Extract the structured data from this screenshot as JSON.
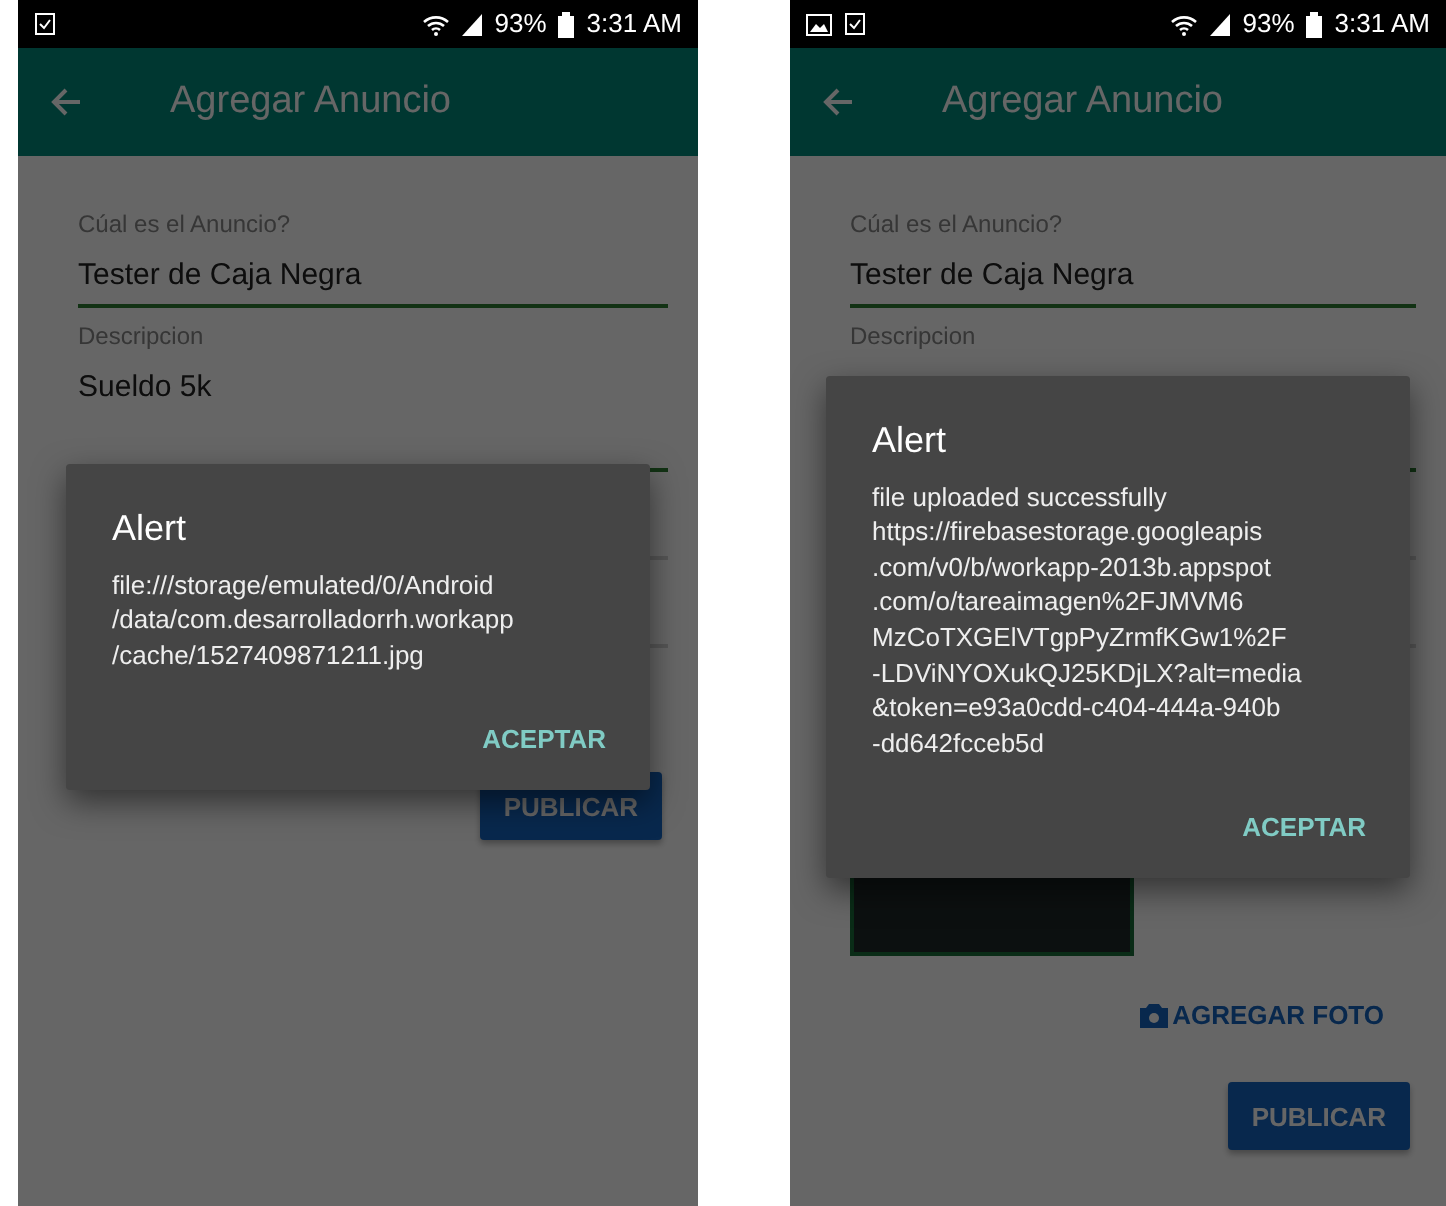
{
  "phones": [
    {
      "status_bar": {
        "notifications": [
          {
            "kind": "clipboard"
          }
        ],
        "battery": "93%",
        "time": "3:31 AM"
      },
      "app_bar": {
        "title": "Agregar Anuncio"
      },
      "form": {
        "fields": [
          {
            "kind": "text",
            "label": "Cúal es el Anuncio?",
            "value": "Tester de Caja Negra"
          },
          {
            "kind": "multiline",
            "label": "Descripcion",
            "value": "Sueldo 5k"
          },
          {
            "kind": "blank"
          },
          {
            "kind": "blank"
          }
        ],
        "publish_button": "PUBLICAR"
      },
      "dialog": {
        "title": "Alert",
        "message_lines": [
          "file:///storage/emulated/0/Android",
          "/data/com.desarrolladorrh.workapp",
          "/cache/1527409871211.jpg"
        ],
        "button": "ACEPTAR"
      }
    },
    {
      "status_bar": {
        "notifications": [
          {
            "kind": "image"
          },
          {
            "kind": "clipboard"
          }
        ],
        "battery": "93%",
        "time": "3:31 AM"
      },
      "app_bar": {
        "title": "Agregar Anuncio"
      },
      "form": {
        "fields": [
          {
            "kind": "text",
            "label": "Cúal es el Anuncio?",
            "value": "Tester de Caja Negra"
          },
          {
            "kind": "multiline",
            "label": "Descripcion"
          },
          {
            "kind": "blank"
          },
          {
            "kind": "blank"
          }
        ],
        "photo_attached": true,
        "add_photo_button": "AGREGAR FOTO",
        "publish_button": "PUBLICAR"
      },
      "dialog": {
        "title": "Alert",
        "message_lines": [
          "file uploaded successfully",
          "https://firebasestorage.googleapis",
          ".com/v0/b/workapp-2013b.appspot",
          ".com/o/tareaimagen%2FJMVM6",
          "MzCoTXGElVTgpPyZrmfKGw1%2F",
          "-LDViNYOXukQJ25KDjLX?alt=media",
          "&token=e93a0cdd-c404-444a-940b",
          "-dd642fcceb5d"
        ],
        "button": "ACEPTAR"
      }
    }
  ]
}
